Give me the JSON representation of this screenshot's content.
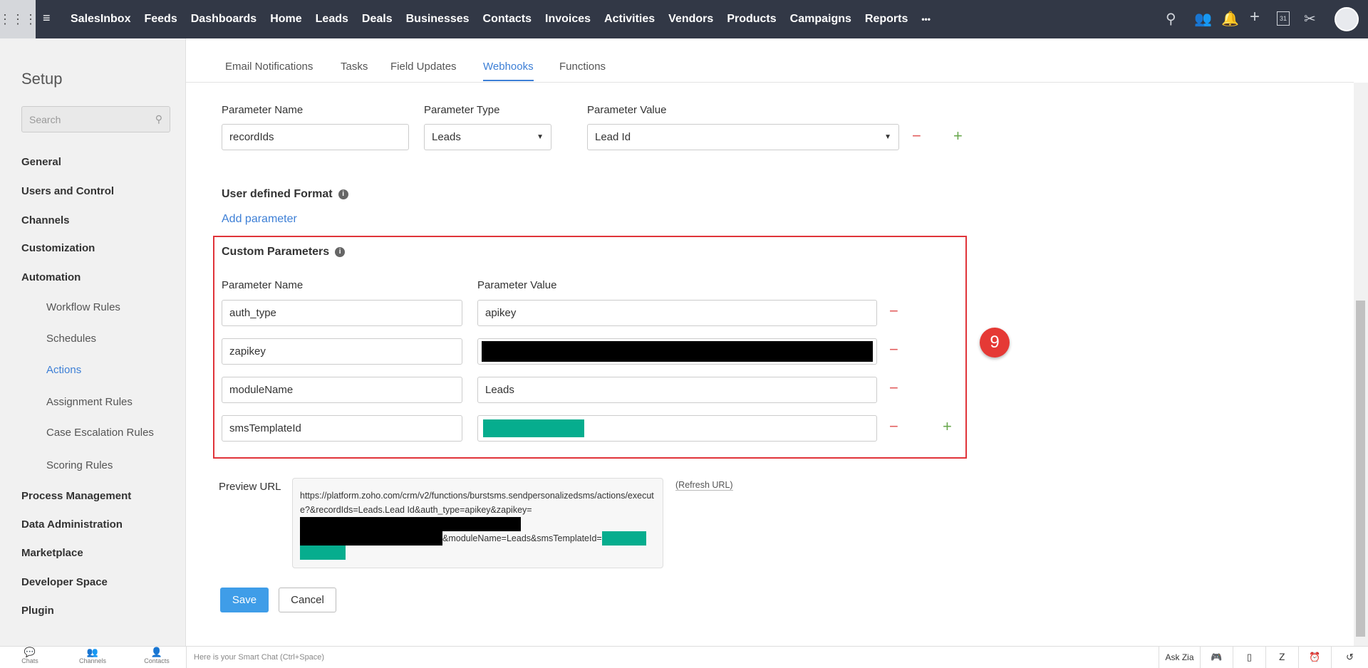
{
  "topbar": {
    "nav": [
      "SalesInbox",
      "Feeds",
      "Dashboards",
      "Home",
      "Leads",
      "Deals",
      "Businesses",
      "Contacts",
      "Invoices",
      "Activities",
      "Vendors",
      "Products",
      "Campaigns",
      "Reports"
    ],
    "more": "•••",
    "calendar_day": "31"
  },
  "sidebar": {
    "title": "Setup",
    "search_placeholder": "Search",
    "items": {
      "general": "General",
      "users": "Users and Control",
      "channels": "Channels",
      "customization": "Customization",
      "automation": "Automation",
      "workflow": "Workflow Rules",
      "schedules": "Schedules",
      "actions": "Actions",
      "assignment": "Assignment Rules",
      "case": "Case Escalation Rules",
      "scoring": "Scoring Rules",
      "process": "Process Management",
      "data": "Data Administration",
      "marketplace": "Marketplace",
      "developer": "Developer Space",
      "plugin": "Plugin"
    }
  },
  "tabs": [
    "Email Notifications",
    "Tasks",
    "Field Updates",
    "Webhooks",
    "Functions"
  ],
  "module_params": {
    "name_label": "Parameter Name",
    "type_label": "Parameter Type",
    "value_label": "Parameter Value",
    "name": "recordIds",
    "type": "Leads",
    "value": "Lead Id"
  },
  "user_format": {
    "title": "User defined Format",
    "add": "Add parameter"
  },
  "custom": {
    "title": "Custom Parameters",
    "name_label": "Parameter Name",
    "value_label": "Parameter Value",
    "rows": [
      {
        "name": "auth_type",
        "value": "apikey"
      },
      {
        "name": "zapikey",
        "value": ""
      },
      {
        "name": "moduleName",
        "value": "Leads"
      },
      {
        "name": "smsTemplateId",
        "value": ""
      }
    ]
  },
  "badge": "9",
  "preview": {
    "label": "Preview URL",
    "line1": "https://platform.zoho.com/crm/v2/functions/burstsms.sendpersonalizedsms/actions/execute?&recordIds=Leads.Lead Id&auth_type=apikey&zapikey=",
    "line2": "&moduleName=Leads&smsTemplateId=",
    "refresh": "(Refresh URL)"
  },
  "buttons": {
    "save": "Save",
    "cancel": "Cancel"
  },
  "bottom": {
    "chats": "Chats",
    "channels": "Channels",
    "contacts": "Contacts",
    "smart_chat": "Here is your Smart Chat (Ctrl+Space)",
    "ask_zia": "Ask Zia"
  }
}
